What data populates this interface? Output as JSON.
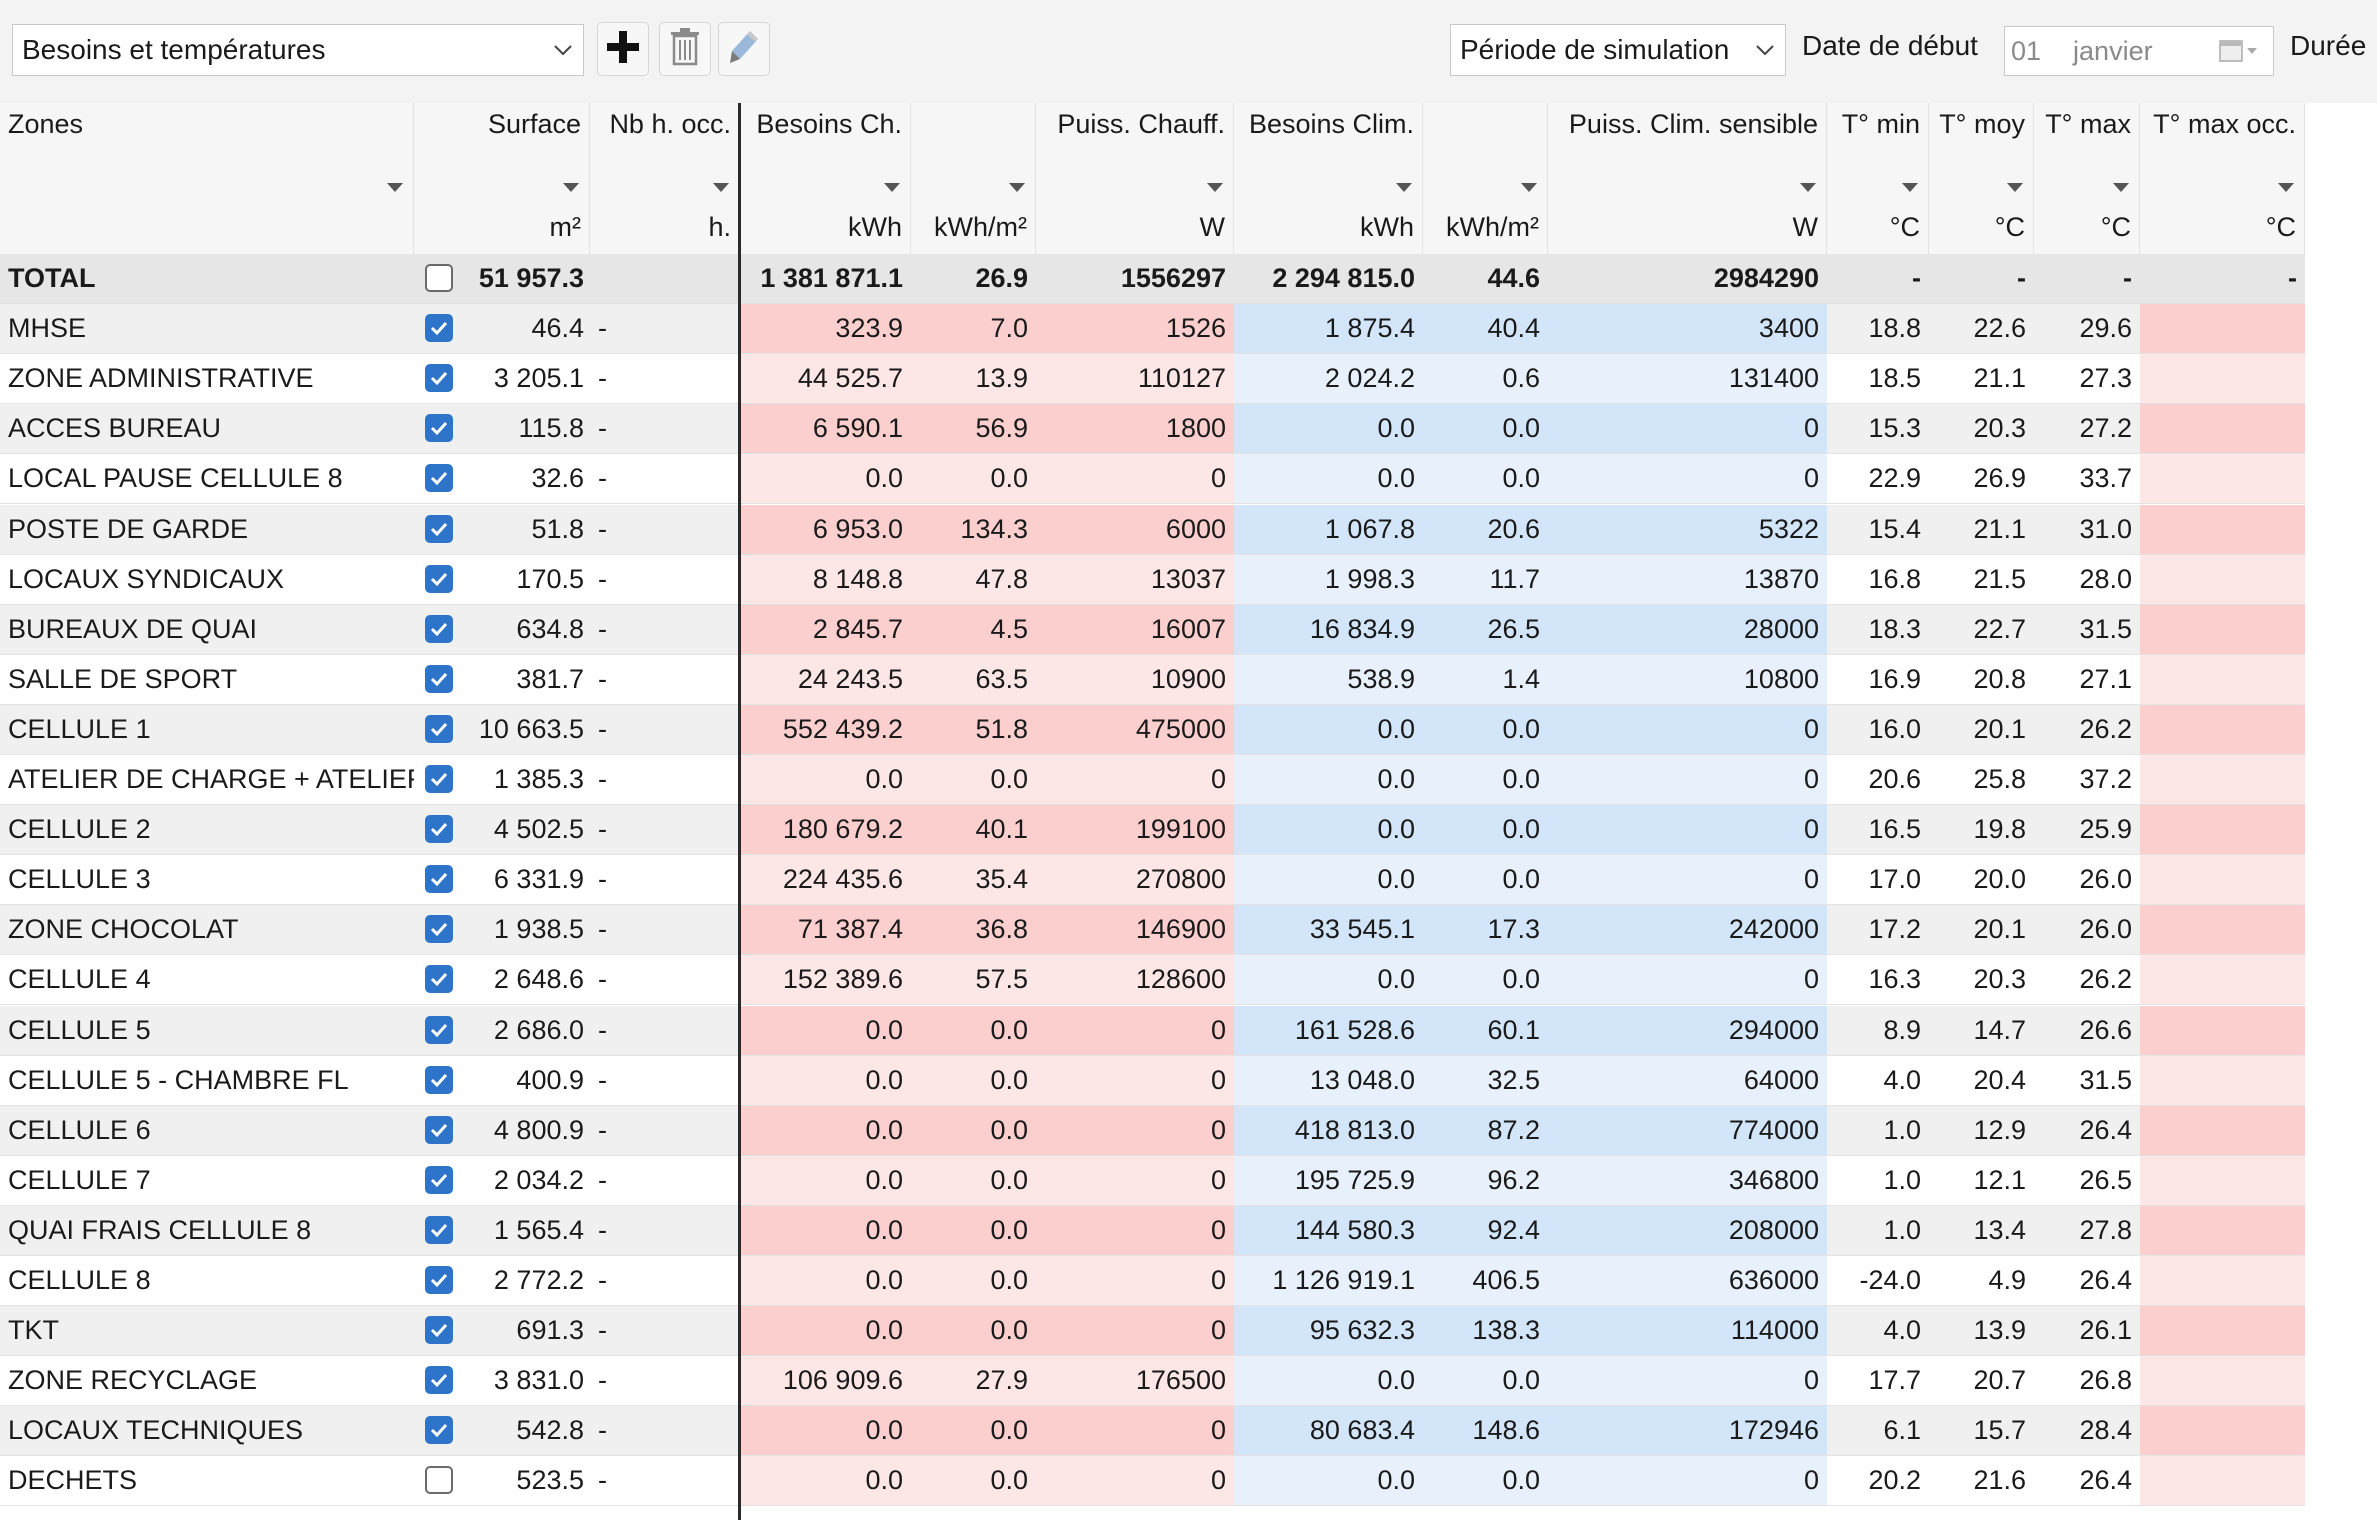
{
  "toolbar": {
    "view_select": "Besoins et températures",
    "period_select": "Période de simulation",
    "start_label": "Date de début",
    "start_day": "01",
    "start_month": "janvier",
    "duration_label": "Durée",
    "icons": [
      "plus-icon",
      "trash-icon",
      "pencil-icon"
    ]
  },
  "table": {
    "columns": [
      {
        "title": "Zones",
        "unit": ""
      },
      {
        "title": "Surface",
        "unit": "m²"
      },
      {
        "title": "Nb h. occ.",
        "unit": "h."
      },
      {
        "title": "Besoins Ch.",
        "unit": "kWh"
      },
      {
        "title": "",
        "unit": "kWh/m²"
      },
      {
        "title": "Puiss. Chauff.",
        "unit": "W"
      },
      {
        "title": "Besoins Clim.",
        "unit": "kWh"
      },
      {
        "title": "",
        "unit": "kWh/m²"
      },
      {
        "title": "Puiss. Clim. sensible",
        "unit": "W"
      },
      {
        "title": "T° min",
        "unit": "°C"
      },
      {
        "title": "T° moy",
        "unit": "°C"
      },
      {
        "title": "T° max",
        "unit": "°C"
      },
      {
        "title": "T° max occ.",
        "unit": "°C"
      }
    ],
    "total": {
      "zone": "TOTAL",
      "checked": false,
      "surface": "51 957.3",
      "hocc": "",
      "bch": "1 381 871.1",
      "bch_m2": "26.9",
      "pch": "1556297",
      "bcl": "2 294 815.0",
      "bcl_m2": "44.6",
      "pcl": "2984290",
      "tmin": "-",
      "tmoy": "-",
      "tmax": "-",
      "tmaxocc": "-"
    },
    "rows": [
      {
        "zone": "MHSE",
        "checked": true,
        "surface": "46.4",
        "hocc": "-",
        "bch": "323.9",
        "bch_m2": "7.0",
        "pch": "1526",
        "bcl": "1 875.4",
        "bcl_m2": "40.4",
        "pcl": "3400",
        "tmin": "18.8",
        "tmoy": "22.6",
        "tmax": "29.6",
        "tmaxocc": ""
      },
      {
        "zone": "ZONE ADMINISTRATIVE",
        "checked": true,
        "surface": "3 205.1",
        "hocc": "-",
        "bch": "44 525.7",
        "bch_m2": "13.9",
        "pch": "110127",
        "bcl": "2 024.2",
        "bcl_m2": "0.6",
        "pcl": "131400",
        "tmin": "18.5",
        "tmoy": "21.1",
        "tmax": "27.3",
        "tmaxocc": ""
      },
      {
        "zone": "ACCES BUREAU",
        "checked": true,
        "surface": "115.8",
        "hocc": "-",
        "bch": "6 590.1",
        "bch_m2": "56.9",
        "pch": "1800",
        "bcl": "0.0",
        "bcl_m2": "0.0",
        "pcl": "0",
        "tmin": "15.3",
        "tmoy": "20.3",
        "tmax": "27.2",
        "tmaxocc": ""
      },
      {
        "zone": "LOCAL PAUSE CELLULE 8",
        "checked": true,
        "surface": "32.6",
        "hocc": "-",
        "bch": "0.0",
        "bch_m2": "0.0",
        "pch": "0",
        "bcl": "0.0",
        "bcl_m2": "0.0",
        "pcl": "0",
        "tmin": "22.9",
        "tmoy": "26.9",
        "tmax": "33.7",
        "tmaxocc": ""
      },
      {
        "zone": "POSTE DE GARDE",
        "checked": true,
        "surface": "51.8",
        "hocc": "-",
        "bch": "6 953.0",
        "bch_m2": "134.3",
        "pch": "6000",
        "bcl": "1 067.8",
        "bcl_m2": "20.6",
        "pcl": "5322",
        "tmin": "15.4",
        "tmoy": "21.1",
        "tmax": "31.0",
        "tmaxocc": ""
      },
      {
        "zone": "LOCAUX SYNDICAUX",
        "checked": true,
        "surface": "170.5",
        "hocc": "-",
        "bch": "8 148.8",
        "bch_m2": "47.8",
        "pch": "13037",
        "bcl": "1 998.3",
        "bcl_m2": "11.7",
        "pcl": "13870",
        "tmin": "16.8",
        "tmoy": "21.5",
        "tmax": "28.0",
        "tmaxocc": ""
      },
      {
        "zone": "BUREAUX DE QUAI",
        "checked": true,
        "surface": "634.8",
        "hocc": "-",
        "bch": "2 845.7",
        "bch_m2": "4.5",
        "pch": "16007",
        "bcl": "16 834.9",
        "bcl_m2": "26.5",
        "pcl": "28000",
        "tmin": "18.3",
        "tmoy": "22.7",
        "tmax": "31.5",
        "tmaxocc": ""
      },
      {
        "zone": "SALLE DE SPORT",
        "checked": true,
        "surface": "381.7",
        "hocc": "-",
        "bch": "24 243.5",
        "bch_m2": "63.5",
        "pch": "10900",
        "bcl": "538.9",
        "bcl_m2": "1.4",
        "pcl": "10800",
        "tmin": "16.9",
        "tmoy": "20.8",
        "tmax": "27.1",
        "tmaxocc": ""
      },
      {
        "zone": "CELLULE 1",
        "checked": true,
        "surface": "10 663.5",
        "hocc": "-",
        "bch": "552 439.2",
        "bch_m2": "51.8",
        "pch": "475000",
        "bcl": "0.0",
        "bcl_m2": "0.0",
        "pcl": "0",
        "tmin": "16.0",
        "tmoy": "20.1",
        "tmax": "26.2",
        "tmaxocc": ""
      },
      {
        "zone": "ATELIER DE CHARGE + ATELIER",
        "checked": true,
        "surface": "1 385.3",
        "hocc": "-",
        "bch": "0.0",
        "bch_m2": "0.0",
        "pch": "0",
        "bcl": "0.0",
        "bcl_m2": "0.0",
        "pcl": "0",
        "tmin": "20.6",
        "tmoy": "25.8",
        "tmax": "37.2",
        "tmaxocc": ""
      },
      {
        "zone": "CELLULE 2",
        "checked": true,
        "surface": "4 502.5",
        "hocc": "-",
        "bch": "180 679.2",
        "bch_m2": "40.1",
        "pch": "199100",
        "bcl": "0.0",
        "bcl_m2": "0.0",
        "pcl": "0",
        "tmin": "16.5",
        "tmoy": "19.8",
        "tmax": "25.9",
        "tmaxocc": ""
      },
      {
        "zone": "CELLULE 3",
        "checked": true,
        "surface": "6 331.9",
        "hocc": "-",
        "bch": "224 435.6",
        "bch_m2": "35.4",
        "pch": "270800",
        "bcl": "0.0",
        "bcl_m2": "0.0",
        "pcl": "0",
        "tmin": "17.0",
        "tmoy": "20.0",
        "tmax": "26.0",
        "tmaxocc": ""
      },
      {
        "zone": "ZONE CHOCOLAT",
        "checked": true,
        "surface": "1 938.5",
        "hocc": "-",
        "bch": "71 387.4",
        "bch_m2": "36.8",
        "pch": "146900",
        "bcl": "33 545.1",
        "bcl_m2": "17.3",
        "pcl": "242000",
        "tmin": "17.2",
        "tmoy": "20.1",
        "tmax": "26.0",
        "tmaxocc": ""
      },
      {
        "zone": "CELLULE 4",
        "checked": true,
        "surface": "2 648.6",
        "hocc": "-",
        "bch": "152 389.6",
        "bch_m2": "57.5",
        "pch": "128600",
        "bcl": "0.0",
        "bcl_m2": "0.0",
        "pcl": "0",
        "tmin": "16.3",
        "tmoy": "20.3",
        "tmax": "26.2",
        "tmaxocc": ""
      },
      {
        "zone": "CELLULE 5",
        "checked": true,
        "surface": "2 686.0",
        "hocc": "-",
        "bch": "0.0",
        "bch_m2": "0.0",
        "pch": "0",
        "bcl": "161 528.6",
        "bcl_m2": "60.1",
        "pcl": "294000",
        "tmin": "8.9",
        "tmoy": "14.7",
        "tmax": "26.6",
        "tmaxocc": ""
      },
      {
        "zone": "CELLULE 5 - CHAMBRE FL",
        "checked": true,
        "surface": "400.9",
        "hocc": "-",
        "bch": "0.0",
        "bch_m2": "0.0",
        "pch": "0",
        "bcl": "13 048.0",
        "bcl_m2": "32.5",
        "pcl": "64000",
        "tmin": "4.0",
        "tmoy": "20.4",
        "tmax": "31.5",
        "tmaxocc": ""
      },
      {
        "zone": "CELLULE 6",
        "checked": true,
        "surface": "4 800.9",
        "hocc": "-",
        "bch": "0.0",
        "bch_m2": "0.0",
        "pch": "0",
        "bcl": "418 813.0",
        "bcl_m2": "87.2",
        "pcl": "774000",
        "tmin": "1.0",
        "tmoy": "12.9",
        "tmax": "26.4",
        "tmaxocc": ""
      },
      {
        "zone": "CELLULE 7",
        "checked": true,
        "surface": "2 034.2",
        "hocc": "-",
        "bch": "0.0",
        "bch_m2": "0.0",
        "pch": "0",
        "bcl": "195 725.9",
        "bcl_m2": "96.2",
        "pcl": "346800",
        "tmin": "1.0",
        "tmoy": "12.1",
        "tmax": "26.5",
        "tmaxocc": ""
      },
      {
        "zone": "QUAI FRAIS CELLULE 8",
        "checked": true,
        "surface": "1 565.4",
        "hocc": "-",
        "bch": "0.0",
        "bch_m2": "0.0",
        "pch": "0",
        "bcl": "144 580.3",
        "bcl_m2": "92.4",
        "pcl": "208000",
        "tmin": "1.0",
        "tmoy": "13.4",
        "tmax": "27.8",
        "tmaxocc": ""
      },
      {
        "zone": "CELLULE 8",
        "checked": true,
        "surface": "2 772.2",
        "hocc": "-",
        "bch": "0.0",
        "bch_m2": "0.0",
        "pch": "0",
        "bcl": "1 126 919.1",
        "bcl_m2": "406.5",
        "pcl": "636000",
        "tmin": "-24.0",
        "tmoy": "4.9",
        "tmax": "26.4",
        "tmaxocc": ""
      },
      {
        "zone": "TKT",
        "checked": true,
        "surface": "691.3",
        "hocc": "-",
        "bch": "0.0",
        "bch_m2": "0.0",
        "pch": "0",
        "bcl": "95 632.3",
        "bcl_m2": "138.3",
        "pcl": "114000",
        "tmin": "4.0",
        "tmoy": "13.9",
        "tmax": "26.1",
        "tmaxocc": ""
      },
      {
        "zone": "ZONE RECYCLAGE",
        "checked": true,
        "surface": "3 831.0",
        "hocc": "-",
        "bch": "106 909.6",
        "bch_m2": "27.9",
        "pch": "176500",
        "bcl": "0.0",
        "bcl_m2": "0.0",
        "pcl": "0",
        "tmin": "17.7",
        "tmoy": "20.7",
        "tmax": "26.8",
        "tmaxocc": ""
      },
      {
        "zone": "LOCAUX TECHNIQUES",
        "checked": true,
        "surface": "542.8",
        "hocc": "-",
        "bch": "0.0",
        "bch_m2": "0.0",
        "pch": "0",
        "bcl": "80 683.4",
        "bcl_m2": "148.6",
        "pcl": "172946",
        "tmin": "6.1",
        "tmoy": "15.7",
        "tmax": "28.4",
        "tmaxocc": ""
      },
      {
        "zone": "DECHETS",
        "checked": false,
        "surface": "523.5",
        "hocc": "-",
        "bch": "0.0",
        "bch_m2": "0.0",
        "pch": "0",
        "bcl": "0.0",
        "bcl_m2": "0.0",
        "pcl": "0",
        "tmin": "20.2",
        "tmoy": "21.6",
        "tmax": "26.4",
        "tmaxocc": ""
      }
    ]
  },
  "colors": {
    "toolbar_bg": "#f3f3f3",
    "row_odd": "#ffffff",
    "row_even": "#f0f0f0",
    "total_bg": "#e6e6e6",
    "heat_light": "#fde6e6",
    "heat_dark": "#fccfcf",
    "cool_light": "#e8f1fb",
    "cool_dark": "#d3e6f9",
    "checkbox_on": "#2e74c9"
  }
}
